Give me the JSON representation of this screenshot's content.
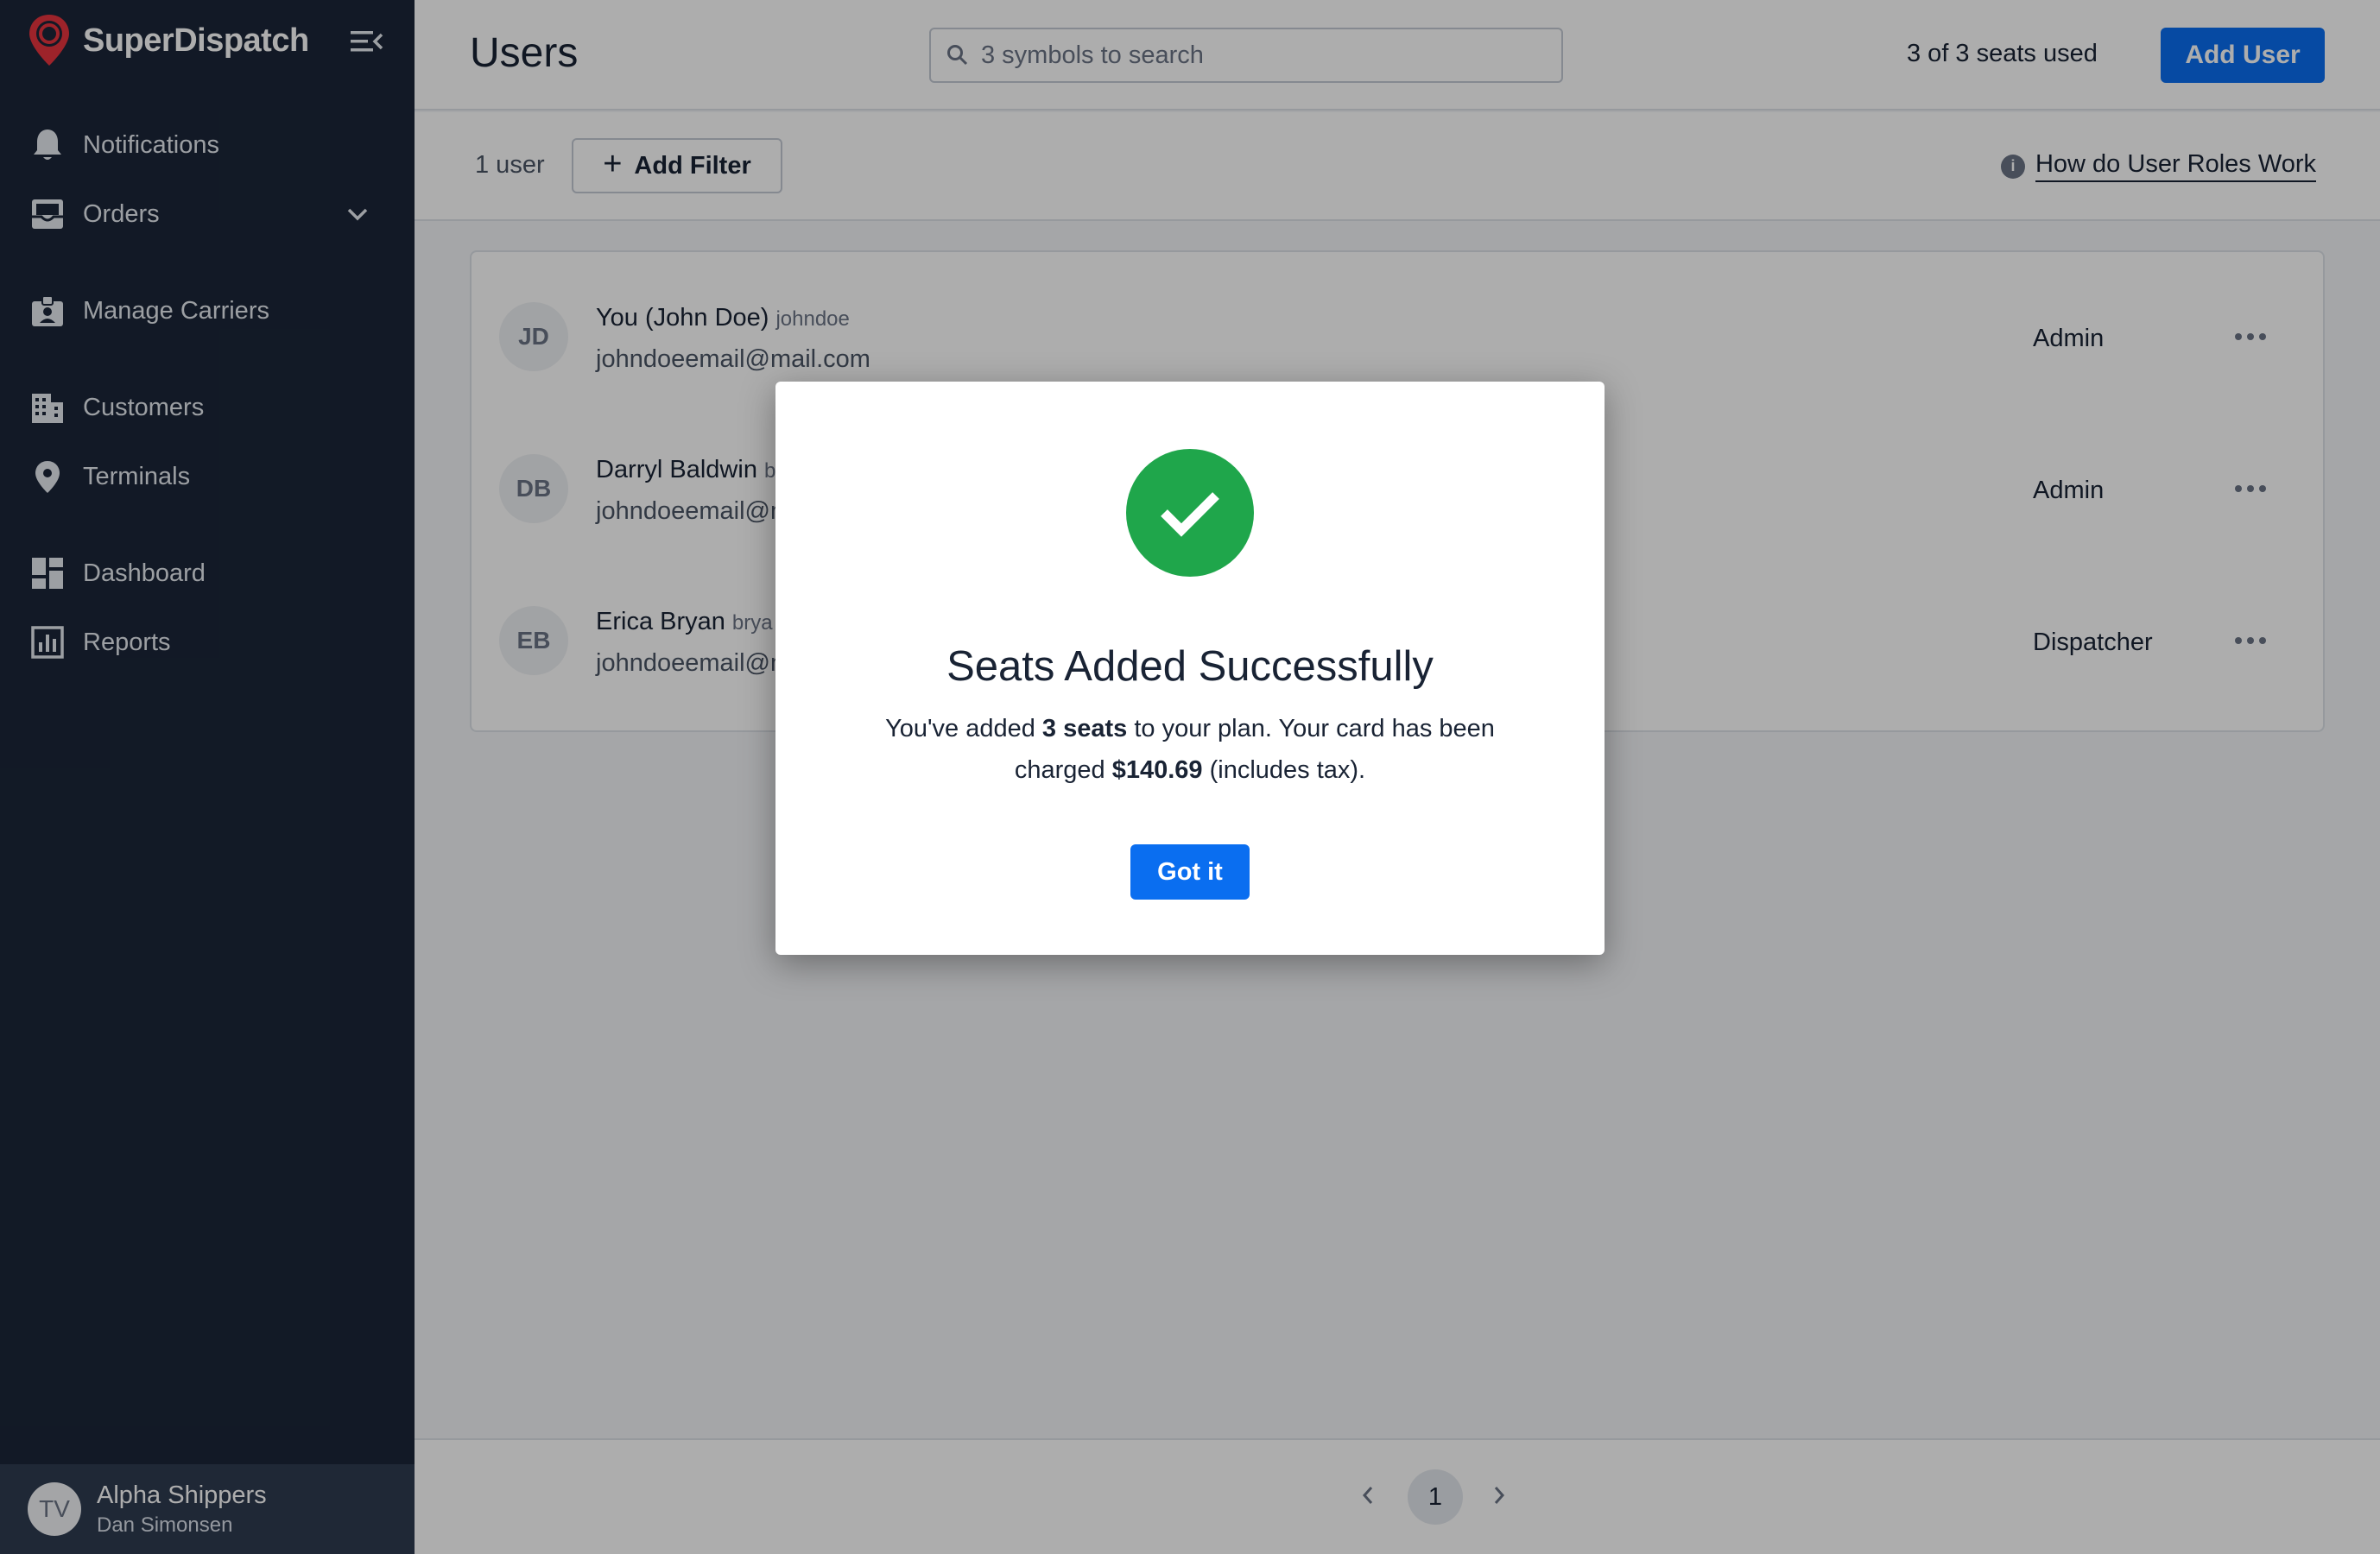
{
  "sidebar": {
    "brand": "SuperDispatch",
    "items": [
      {
        "label": "Notifications",
        "icon": "bell-icon"
      },
      {
        "label": "Orders",
        "icon": "inbox-icon"
      },
      {
        "label": "Manage Carriers",
        "icon": "carrier-badge-icon"
      },
      {
        "label": "Customers",
        "icon": "building-icon"
      },
      {
        "label": "Terminals",
        "icon": "location-pin-icon"
      },
      {
        "label": "Dashboard",
        "icon": "dashboard-icon"
      },
      {
        "label": "Reports",
        "icon": "bar-chart-icon"
      }
    ],
    "account": {
      "initials": "TV",
      "company": "Alpha Shippers",
      "user": "Dan Simonsen"
    }
  },
  "header": {
    "title": "Users",
    "search_placeholder": "3 symbols to search",
    "seats_text": "3 of 3 seats used",
    "add_user_label": "Add User"
  },
  "filter": {
    "count_text": "1 user",
    "add_filter_label": "Add Filter",
    "roles_link": "How do User Roles Work"
  },
  "users": [
    {
      "initials": "JD",
      "name": "You (John Doe)",
      "login": "johndoe",
      "email": "johndoeemail@mail.com",
      "role": "Admin"
    },
    {
      "initials": "DB",
      "name": "Darryl Baldwin",
      "login": "b",
      "email": "johndoeemail@m",
      "role": "Admin"
    },
    {
      "initials": "EB",
      "name": "Erica Bryan",
      "login": "brya",
      "email": "johndoeemail@m",
      "role": "Dispatcher"
    }
  ],
  "pagination": {
    "current_page": "1"
  },
  "modal": {
    "title": "Seats Added Successfully",
    "body_prefix": "You've added ",
    "seats": "3 seats",
    "body_middle": " to your plan. Your card has been charged ",
    "amount": "$140.69",
    "body_suffix": " (includes tax).",
    "button": "Got it"
  },
  "colors": {
    "sidebar_bg": "#1b2638",
    "accent_blue": "#0a6ef0",
    "success_green": "#1fa64b",
    "brand_red": "#e8343e"
  }
}
